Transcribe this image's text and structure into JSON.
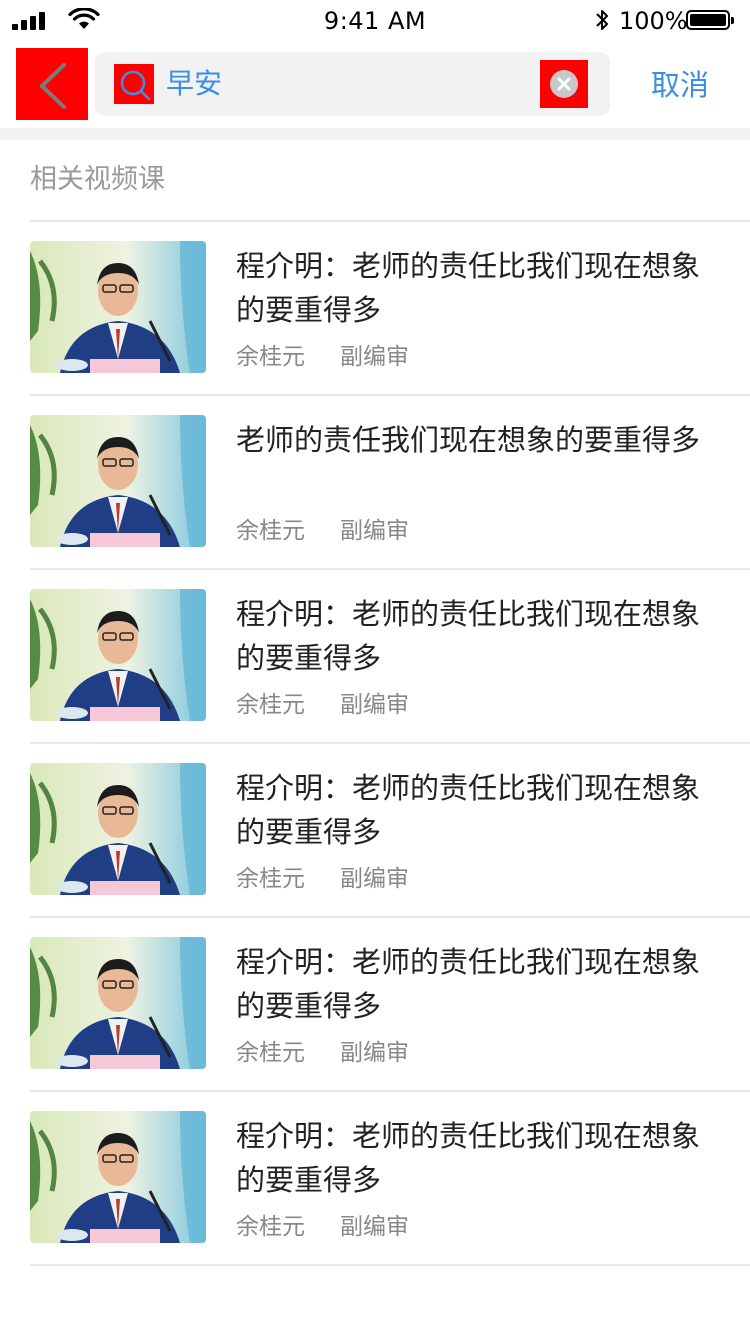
{
  "status_bar": {
    "time": "9:41 AM",
    "battery_percent": "100%",
    "icons": [
      "signal-icon",
      "wifi-icon",
      "bluetooth-icon",
      "battery-icon"
    ]
  },
  "search": {
    "query": "早安",
    "cancel_label": "取消",
    "icons": [
      "back-chevron-icon",
      "search-icon",
      "clear-icon"
    ]
  },
  "section": {
    "title": "相关视频课"
  },
  "colors": {
    "accent": "#3a8ee6",
    "highlight": "#ff0000",
    "divider": "#e6e6e6",
    "muted_text": "#888888"
  },
  "courses": [
    {
      "title": "程介明：老师的责任比我们现在想象的要重得多",
      "author": "余桂元",
      "role": "副编审"
    },
    {
      "title": "老师的责任我们现在想象的要重得多",
      "author": "余桂元",
      "role": "副编审"
    },
    {
      "title": "程介明：老师的责任比我们现在想象的要重得多",
      "author": "余桂元",
      "role": "副编审"
    },
    {
      "title": "程介明：老师的责任比我们现在想象的要重得多",
      "author": "余桂元",
      "role": "副编审"
    },
    {
      "title": "程介明：老师的责任比我们现在想象的要重得多",
      "author": "余桂元",
      "role": "副编审"
    },
    {
      "title": "程介明：老师的责任比我们现在想象的要重得多",
      "author": "余桂元",
      "role": "副编审"
    }
  ]
}
